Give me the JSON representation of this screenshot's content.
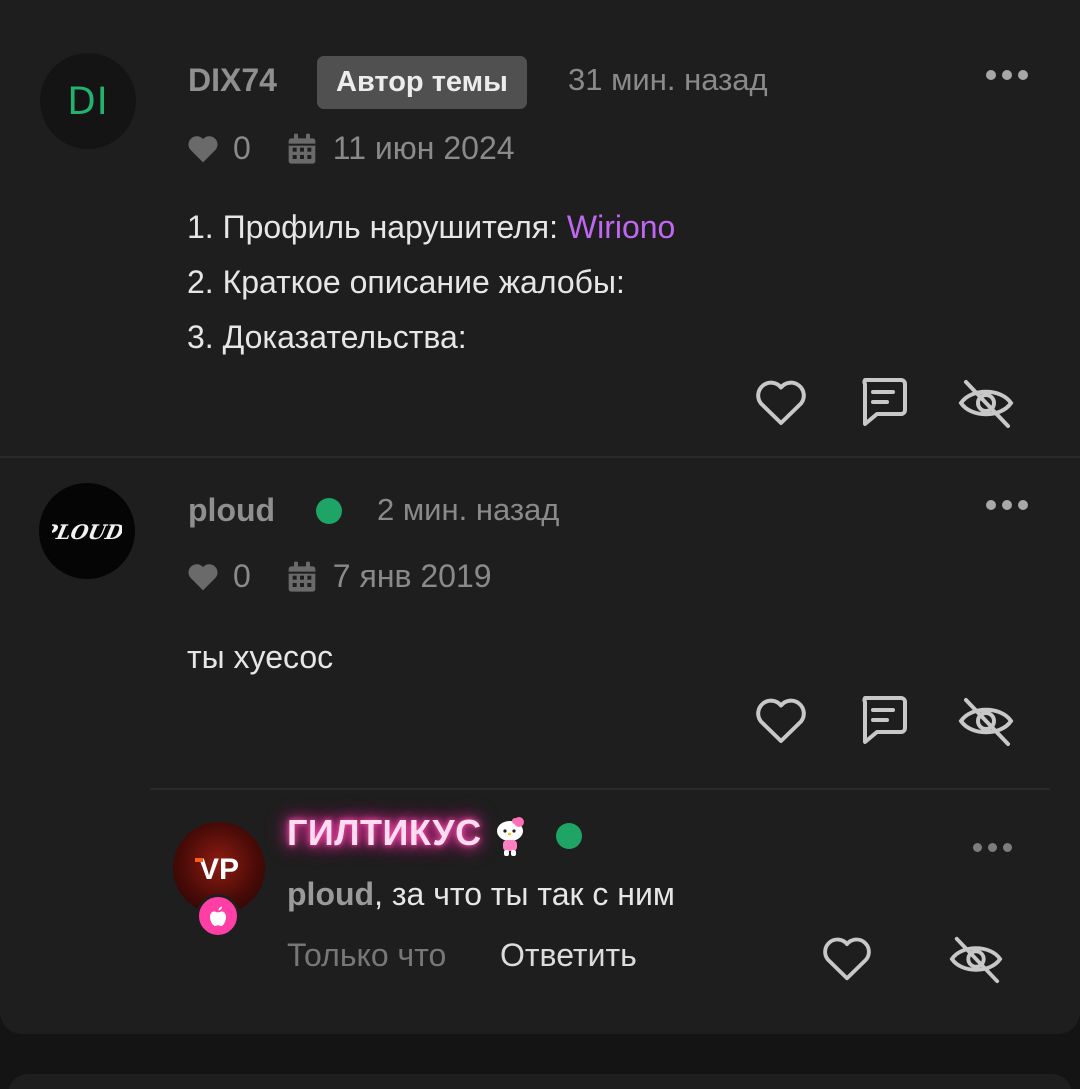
{
  "post1": {
    "avatar_initials": "DI",
    "username": "DIX74",
    "badge": "Автор темы",
    "time": "31 мин. назад",
    "likes": "0",
    "date": "11 июн 2024",
    "lines": [
      {
        "prefix": "1. Профиль нарушителя: ",
        "link": "Wiriono"
      },
      {
        "text": "2. Краткое описание жалобы:"
      },
      {
        "text": "3. Доказательства:"
      }
    ]
  },
  "post2": {
    "avatar_logo": "PLOUD",
    "username": "ploud",
    "time": "2 мин. назад",
    "likes": "0",
    "date": "7 янв 2019",
    "text": "ты хуесос"
  },
  "reply": {
    "avatar_logo": "VP",
    "username": "ГИЛТИКУС",
    "mention": "ploud",
    "text": ", за что ты так с ним",
    "time": "Только что",
    "reply_label": "Ответить"
  },
  "colors": {
    "online": "#1ea566",
    "link": "#c067f2",
    "avatar_initials": "#22b46e",
    "neon_name": "#ff4fb2"
  },
  "icons": [
    "heart-icon",
    "calendar-icon",
    "comment-icon",
    "eye-off-icon",
    "more-icon",
    "apple-icon",
    "hello-kitty-icon"
  ]
}
